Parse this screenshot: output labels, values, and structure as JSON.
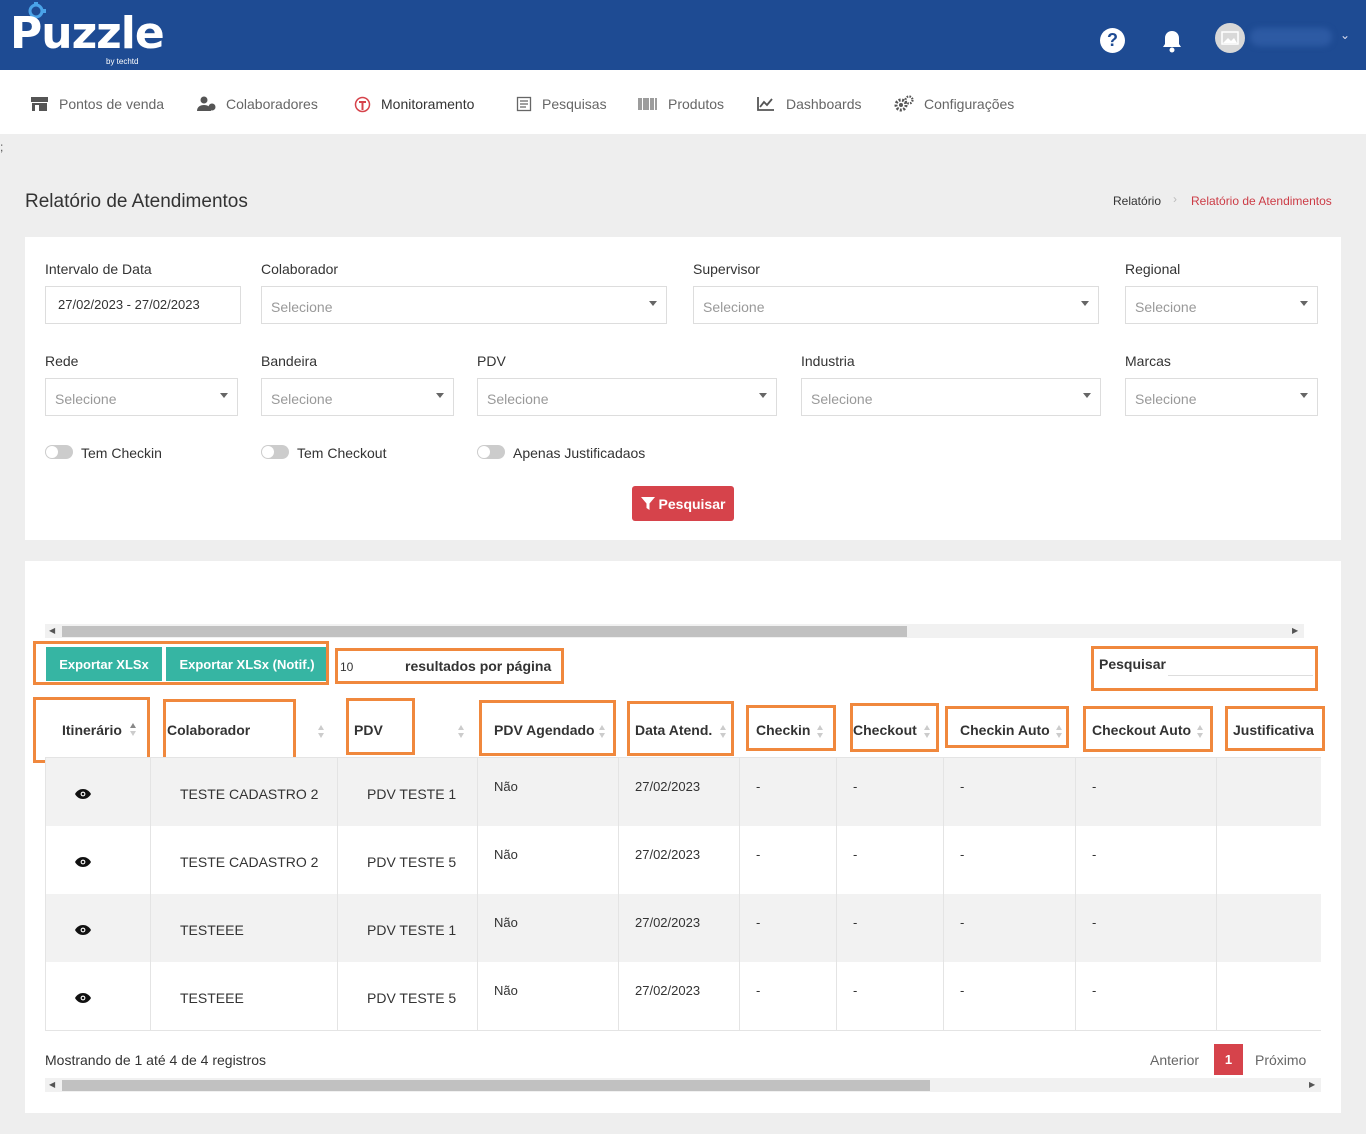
{
  "brand": {
    "name": "Puzzle",
    "sub": "by techtd"
  },
  "header": {
    "help_icon": "?",
    "user_caret": "⌄"
  },
  "nav": [
    {
      "label": "Pontos de venda",
      "icon": "store-icon"
    },
    {
      "label": "Colaboradores",
      "icon": "users-icon"
    },
    {
      "label": "Monitoramento",
      "icon": "monitor-icon"
    },
    {
      "label": "Pesquisas",
      "icon": "survey-icon"
    },
    {
      "label": "Produtos",
      "icon": "barcode-icon"
    },
    {
      "label": "Dashboards",
      "icon": "chart-icon"
    },
    {
      "label": "Configurações",
      "icon": "gears-icon"
    }
  ],
  "stray_char": ";",
  "page": {
    "title": "Relatório de Atendimentos",
    "breadcrumb": [
      "Relatório",
      "Relatório de Atendimentos"
    ],
    "breadcrumb_sep": "›"
  },
  "filters": {
    "date_label": "Intervalo de Data",
    "date_value": "27/02/2023 - 27/02/2023",
    "colaborador_label": "Colaborador",
    "supervisor_label": "Supervisor",
    "regional_label": "Regional",
    "rede_label": "Rede",
    "bandeira_label": "Bandeira",
    "pdv_label": "PDV",
    "industria_label": "Industria",
    "marcas_label": "Marcas",
    "placeholder": "Selecione",
    "toggle_checkin": "Tem Checkin",
    "toggle_checkout": "Tem Checkout",
    "toggle_justificadas": "Apenas Justificadaos",
    "search_button": "Pesquisar"
  },
  "results": {
    "export_xlsx": "Exportar XLSx",
    "export_xlsx_notif": "Exportar XLSx (Notif.)",
    "page_size": "10",
    "page_size_label": "resultados por página",
    "search_label": "Pesquisar",
    "columns": [
      "Itinerário",
      "Colaborador",
      "PDV",
      "PDV Agendado",
      "Data Atend.",
      "Checkin",
      "Checkout",
      "Checkin Auto",
      "Checkout Auto",
      "Justificativa"
    ],
    "rows": [
      {
        "colaborador": "TESTE CADASTRO 2",
        "pdv": "PDV TESTE 1",
        "agendado": "Não",
        "data": "27/02/2023",
        "checkin": "-",
        "checkout": "-",
        "checkin_auto": "-",
        "checkout_auto": "-"
      },
      {
        "colaborador": "TESTE CADASTRO 2",
        "pdv": "PDV TESTE 5",
        "agendado": "Não",
        "data": "27/02/2023",
        "checkin": "-",
        "checkout": "-",
        "checkin_auto": "-",
        "checkout_auto": "-"
      },
      {
        "colaborador": "TESTEEE",
        "pdv": "PDV TESTE 1",
        "agendado": "Não",
        "data": "27/02/2023",
        "checkin": "-",
        "checkout": "-",
        "checkin_auto": "-",
        "checkout_auto": "-"
      },
      {
        "colaborador": "TESTEEE",
        "pdv": "PDV TESTE 5",
        "agendado": "Não",
        "data": "27/02/2023",
        "checkin": "-",
        "checkout": "-",
        "checkin_auto": "-",
        "checkout_auto": "-"
      }
    ],
    "info": "Mostrando de 1 até 4 de 4 registros",
    "prev": "Anterior",
    "current_page": "1",
    "next": "Próximo"
  },
  "colors": {
    "header": "#1e4b93",
    "accent_red": "#d6434b",
    "export_green": "#36b5a3",
    "highlight": "#f0883d"
  }
}
